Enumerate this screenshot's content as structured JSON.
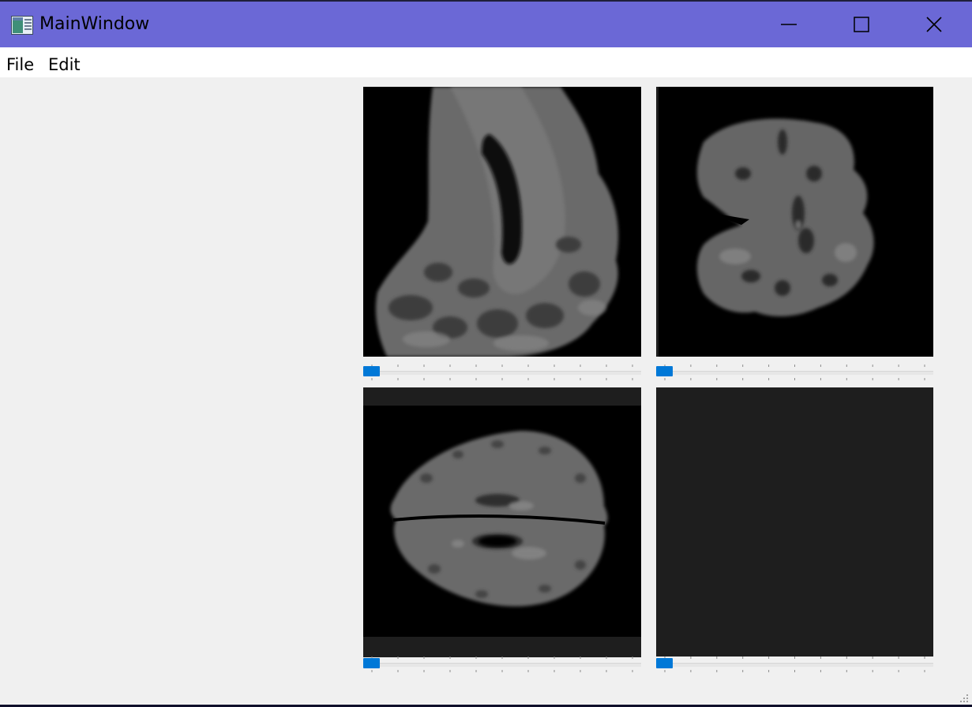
{
  "window": {
    "title": "MainWindow",
    "titlebar_color": "#6b68d6"
  },
  "menubar": {
    "items": [
      {
        "label": "File"
      },
      {
        "label": "Edit"
      }
    ]
  },
  "icons": {
    "app": "app-window-icon",
    "minimize": "minimize-icon",
    "maximize": "maximize-icon",
    "close": "close-icon",
    "size_grip": "size-grip-icon"
  },
  "viewers": [
    {
      "name": "sagittal",
      "content": "brain-mri-slice"
    },
    {
      "name": "coronal",
      "content": "brain-mri-slice"
    },
    {
      "name": "axial",
      "content": "brain-mri-slice"
    },
    {
      "name": "empty",
      "content": "empty"
    }
  ],
  "sliders": [
    {
      "value_fraction": 0.0
    },
    {
      "value_fraction": 0.0
    },
    {
      "value_fraction": 0.0
    },
    {
      "value_fraction": 0.0
    }
  ],
  "colors": {
    "accent": "#0078d7",
    "viewer_bg": "#000000",
    "empty_viewer_bg": "#1e1e1e",
    "window_bg": "#f0f0f0"
  }
}
